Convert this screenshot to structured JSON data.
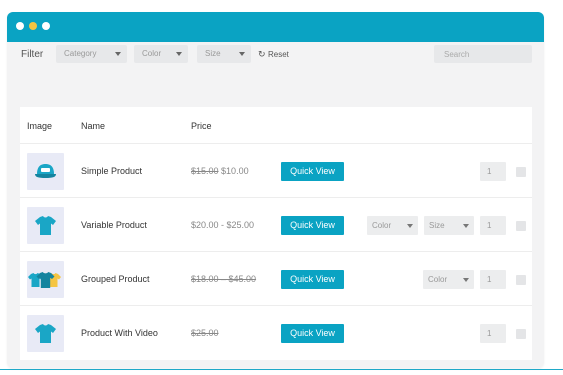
{
  "colors": {
    "accent": "#0aa3c3",
    "dot_yellow": "#f5c542",
    "thumb_bg": "#e8eaf6"
  },
  "filter": {
    "label": "Filter",
    "selects": [
      {
        "label": "Category"
      },
      {
        "label": "Color"
      },
      {
        "label": "Size"
      }
    ],
    "reset_label": "Reset",
    "search_placeholder": "Search"
  },
  "table": {
    "headers": {
      "image": "Image",
      "name": "Name",
      "price": "Price"
    },
    "rows": [
      {
        "name": "Simple Product",
        "price_old": "$15.00",
        "price_new": "$10.00",
        "image_icon": "cap-icon",
        "action_label": "Quick View",
        "variants": [],
        "qty": "1"
      },
      {
        "name": "Variable Product",
        "price": "$20.00 - $25.00",
        "image_icon": "tshirt-icon",
        "action_label": "Quick View",
        "variants": [
          "Color",
          "Size"
        ],
        "qty": "1"
      },
      {
        "name": "Grouped Product",
        "price_range_old": "$18.00 – $45.00",
        "image_icon": "tshirts-group-icon",
        "action_label": "Quick View",
        "variants": [
          "Color"
        ],
        "qty": "1"
      },
      {
        "name": "Product With Video",
        "price_old": "$25.00",
        "image_icon": "tshirt-icon",
        "action_label": "Quick View",
        "variants": [],
        "qty": "1"
      }
    ]
  }
}
